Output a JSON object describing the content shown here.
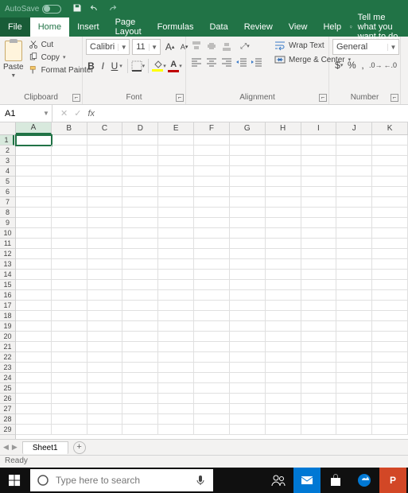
{
  "titlebar": {
    "autosave_label": "AutoSave"
  },
  "tabs": {
    "file": "File",
    "home": "Home",
    "insert": "Insert",
    "pagelayout": "Page Layout",
    "formulas": "Formulas",
    "data": "Data",
    "review": "Review",
    "view": "View",
    "help": "Help",
    "tellme": "Tell me what you want to do"
  },
  "ribbon": {
    "clipboard": {
      "label": "Clipboard",
      "paste": "Paste",
      "cut": "Cut",
      "copy": "Copy",
      "format_painter": "Format Painter"
    },
    "font": {
      "label": "Font",
      "name": "Calibri",
      "size": "11",
      "grow": "A",
      "shrink": "A",
      "bold": "B",
      "italic": "I",
      "underline": "U",
      "fill_color": "#ffff00",
      "font_color": "#c00000"
    },
    "alignment": {
      "label": "Alignment",
      "wrap": "Wrap Text",
      "merge": "Merge & Center"
    },
    "number": {
      "label": "Number",
      "format": "General",
      "currency": "$",
      "percent": "%",
      "comma": ","
    }
  },
  "namebox": {
    "value": "A1"
  },
  "formula_bar": {
    "value": "",
    "fx": "fx"
  },
  "grid": {
    "columns": [
      "A",
      "B",
      "C",
      "D",
      "E",
      "F",
      "G",
      "H",
      "I",
      "J",
      "K"
    ],
    "rows": 29,
    "selected_col": 0,
    "selected_row": 0
  },
  "sheet_tabs": {
    "active": "Sheet1"
  },
  "status": {
    "text": "Ready"
  },
  "taskbar": {
    "search_placeholder": "Type here to search"
  }
}
